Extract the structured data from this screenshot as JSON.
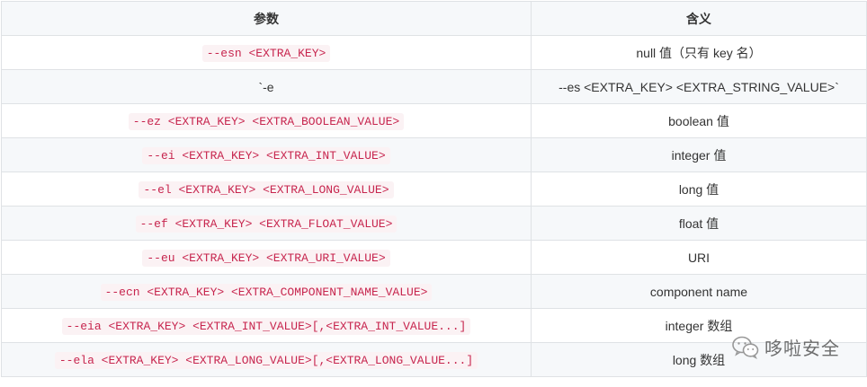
{
  "table": {
    "headers": [
      "参数",
      "含义"
    ],
    "rows": [
      {
        "param": "--esn <EXTRA_KEY>",
        "param_style": "code",
        "meaning": "null 值（只有 key 名）"
      },
      {
        "param": "`-e",
        "param_style": "plain",
        "meaning": "--es <EXTRA_KEY> <EXTRA_STRING_VALUE>`"
      },
      {
        "param": "--ez <EXTRA_KEY> <EXTRA_BOOLEAN_VALUE>",
        "param_style": "code",
        "meaning": "boolean 值"
      },
      {
        "param": "--ei <EXTRA_KEY> <EXTRA_INT_VALUE>",
        "param_style": "code",
        "meaning": "integer 值"
      },
      {
        "param": "--el <EXTRA_KEY> <EXTRA_LONG_VALUE>",
        "param_style": "code",
        "meaning": "long 值"
      },
      {
        "param": "--ef <EXTRA_KEY> <EXTRA_FLOAT_VALUE>",
        "param_style": "code",
        "meaning": "float 值"
      },
      {
        "param": "--eu <EXTRA_KEY> <EXTRA_URI_VALUE>",
        "param_style": "code",
        "meaning": "URI"
      },
      {
        "param": "--ecn <EXTRA_KEY> <EXTRA_COMPONENT_NAME_VALUE>",
        "param_style": "code",
        "meaning": "component name"
      },
      {
        "param": "--eia <EXTRA_KEY> <EXTRA_INT_VALUE>[,<EXTRA_INT_VALUE...]",
        "param_style": "code",
        "meaning": "integer 数组"
      },
      {
        "param": "--ela <EXTRA_KEY> <EXTRA_LONG_VALUE>[,<EXTRA_LONG_VALUE...]",
        "param_style": "code",
        "meaning": "long 数组"
      }
    ]
  },
  "watermark": {
    "icon": "wechat-icon",
    "text": "哆啦安全"
  },
  "colors": {
    "code_text": "#c7254e",
    "code_background": "#fbf2f4",
    "header_background": "#f6f8fa",
    "border": "#dfe2e5"
  }
}
